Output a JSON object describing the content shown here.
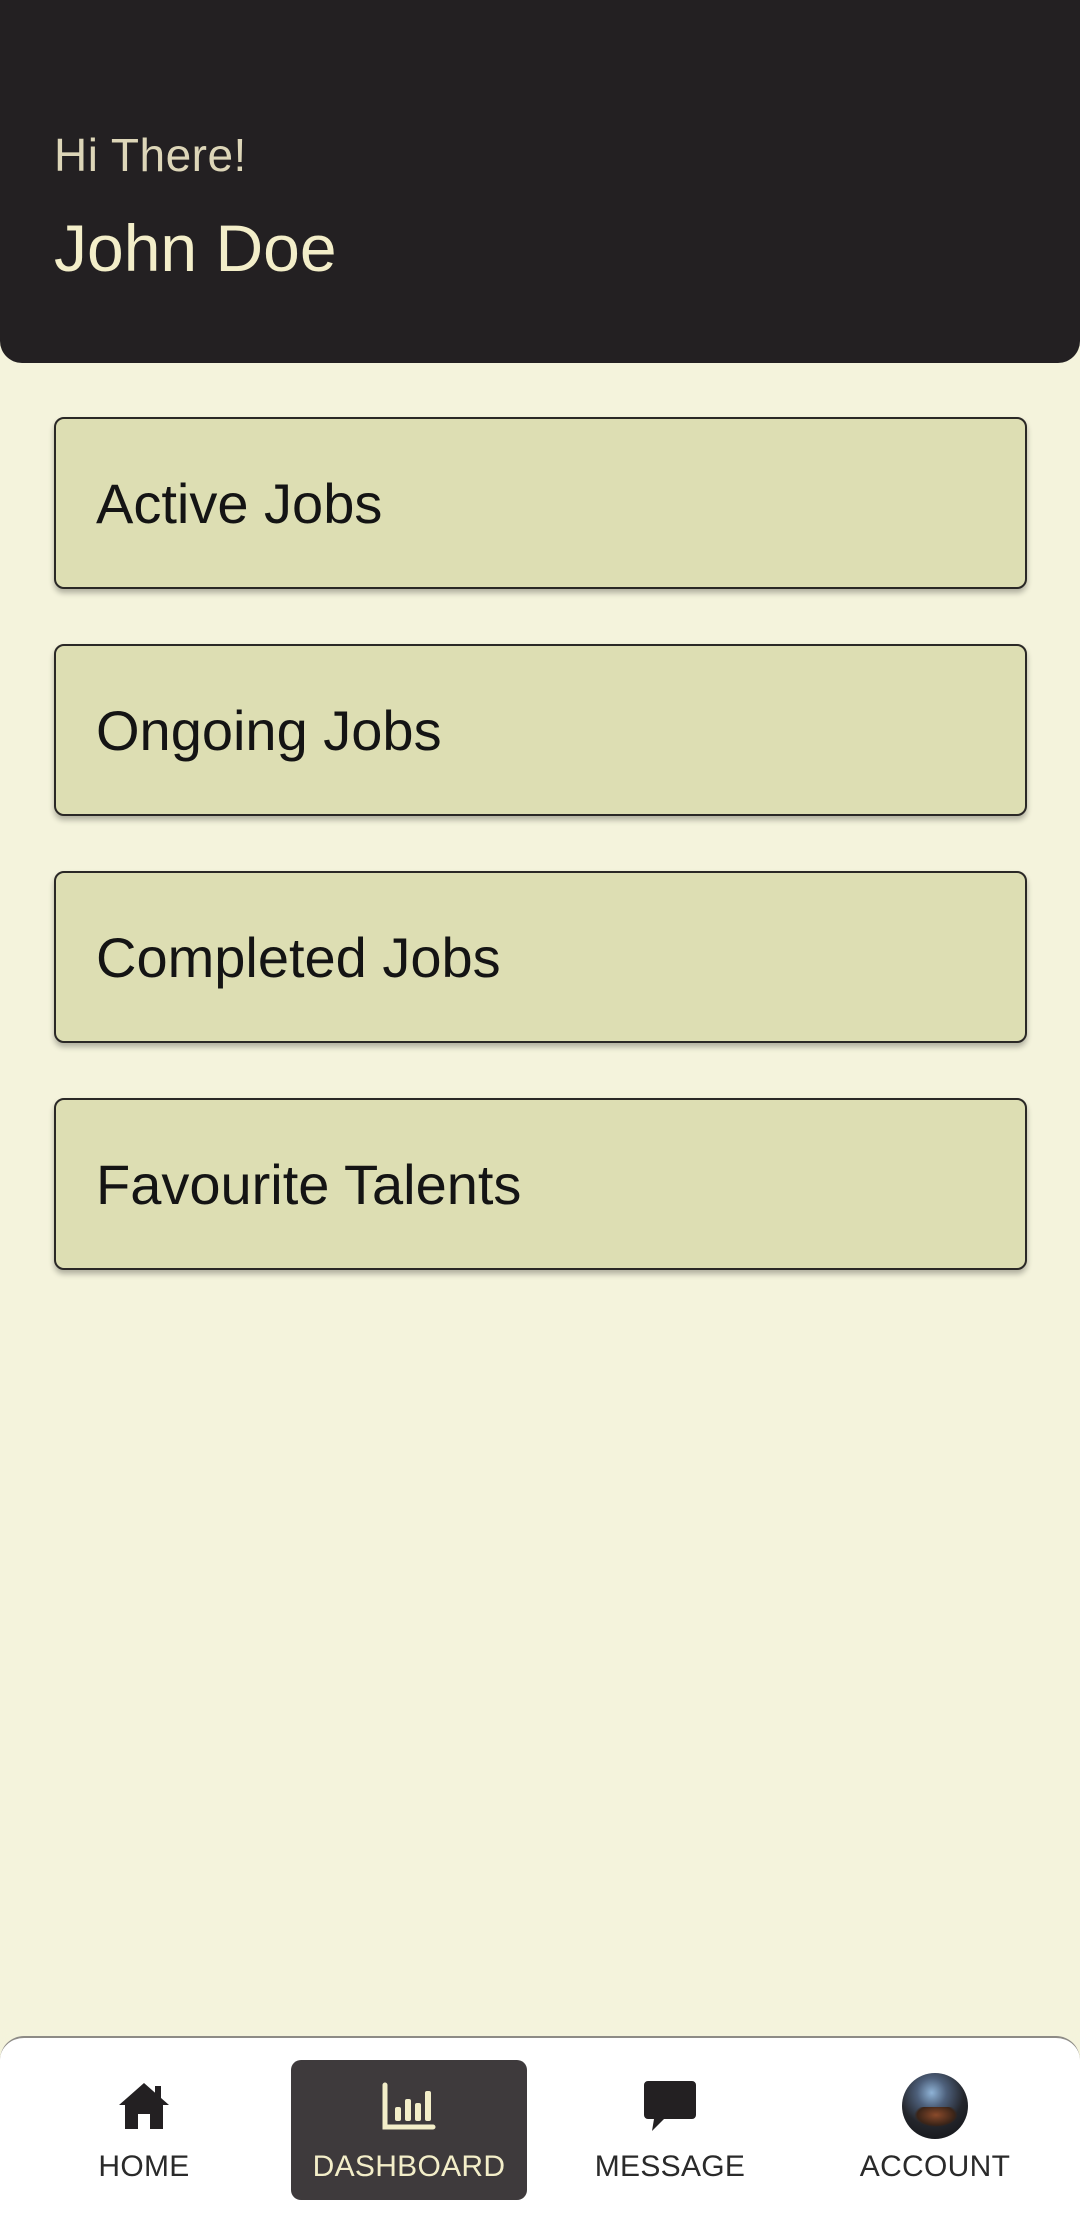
{
  "header": {
    "greeting": "Hi There!",
    "user_name": "John Doe"
  },
  "dashboard": {
    "cards": [
      {
        "label": "Active Jobs"
      },
      {
        "label": "Ongoing Jobs"
      },
      {
        "label": "Completed Jobs"
      },
      {
        "label": "Favourite Talents"
      }
    ]
  },
  "bottom_nav": {
    "active_tab": "dashboard",
    "items": [
      {
        "label": "HOME",
        "icon": "home-icon"
      },
      {
        "label": "DASHBOARD",
        "icon": "bar-chart-icon"
      },
      {
        "label": "MESSAGE",
        "icon": "message-icon"
      },
      {
        "label": "ACCOUNT",
        "icon": "avatar"
      }
    ]
  },
  "colors": {
    "header_bg": "#232022",
    "page_bg": "#f4f3dc",
    "card_bg": "#dddeb3",
    "active_tab_bg": "#3e3a3c",
    "header_text": "#f3eec9"
  }
}
